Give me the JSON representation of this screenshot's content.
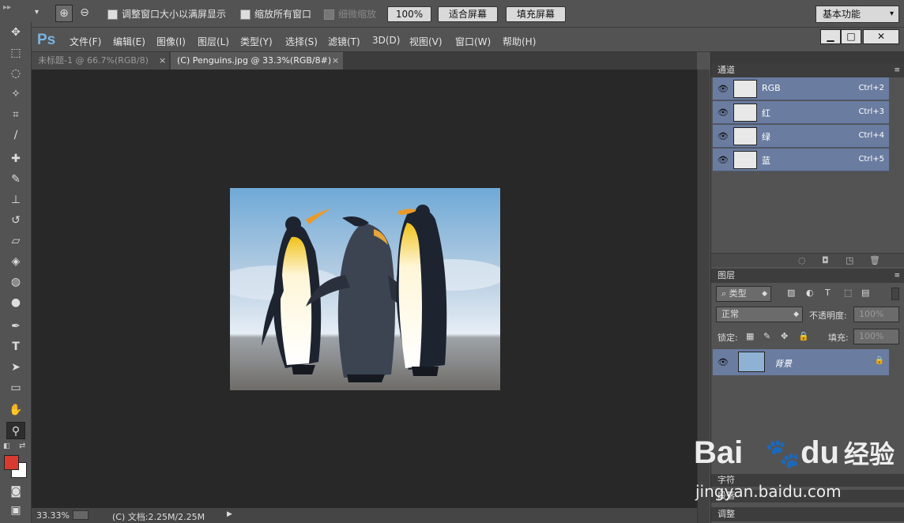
{
  "options_bar": {
    "resize_windows_label": "调整窗口大小以满屏显示",
    "zoom_all_label": "缩放所有窗口",
    "scrubby_zoom_label": "细微缩放",
    "btn_100": "100%",
    "btn_fit": "适合屏幕",
    "btn_fill": "填充屏幕",
    "workspace": "基本功能"
  },
  "menu": {
    "logo": "Ps",
    "items": [
      "文件(F)",
      "编辑(E)",
      "图像(I)",
      "图层(L)",
      "类型(Y)",
      "选择(S)",
      "滤镜(T)",
      "3D(D)",
      "视图(V)",
      "窗口(W)",
      "帮助(H)"
    ]
  },
  "tabs": [
    {
      "label": "未标题-1 @ 66.7%(RGB/8)",
      "close": "×"
    },
    {
      "label": "(C) Penguins.jpg @ 33.3%(RGB/8#)",
      "close": "×"
    }
  ],
  "status": {
    "zoom": "33.33%",
    "doc": "(C) 文档:2.25M/2.25M",
    "arrow": "▶"
  },
  "channels": {
    "title": "通道",
    "rows": [
      {
        "name": "RGB",
        "key": "Ctrl+2"
      },
      {
        "name": "红",
        "key": "Ctrl+3"
      },
      {
        "name": "绿",
        "key": "Ctrl+4"
      },
      {
        "name": "蓝",
        "key": "Ctrl+5"
      }
    ]
  },
  "layers": {
    "title": "图层",
    "filter": "类型",
    "blend": "正常",
    "opacity_label": "不透明度:",
    "opacity_value": "100%",
    "lock_label": "锁定:",
    "fill_label": "填充:",
    "fill_value": "100%",
    "layer_name": "背景"
  },
  "collapsed_panels": {
    "char": "字符",
    "para": "段落",
    "adjust": "调整"
  },
  "watermark": {
    "brand": "Bai",
    "brand2": "du",
    "cn": "经验",
    "url": "jingyan.baidu.com"
  },
  "colors": {
    "fg": "#d93a2f",
    "bg": "#ffffff",
    "sel_row": "#6a7ca0"
  }
}
